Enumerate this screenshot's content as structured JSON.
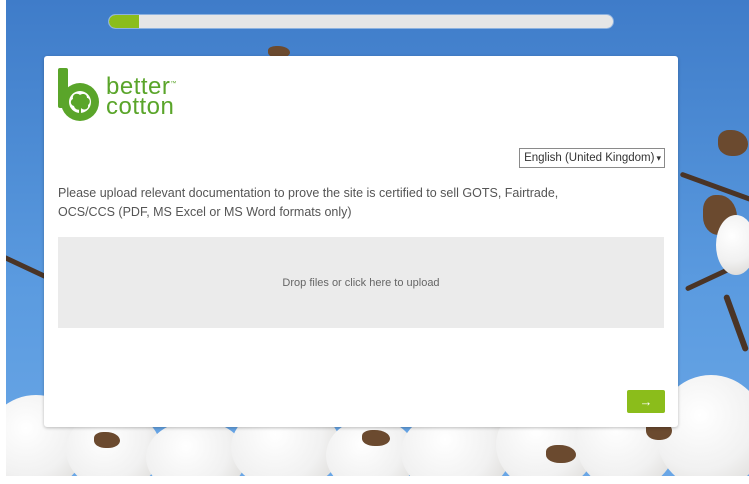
{
  "progress": {
    "percent": 6
  },
  "brand": {
    "line1": "better",
    "line2": "cotton",
    "tm": "™",
    "color": "#5aa52a",
    "logo_icon": "cotton-boll-b-icon"
  },
  "language": {
    "selected": "English (United Kingdom)",
    "chevron_icon": "chevron-down-icon"
  },
  "prompt": {
    "text": "Please upload relevant documentation to prove the site is certified to sell GOTS, Fairtrade, OCS/CCS (PDF, MS Excel or MS Word formats only)"
  },
  "upload": {
    "label": "Drop files or click here to upload"
  },
  "next": {
    "label": "→",
    "icon": "arrow-right-icon",
    "color": "#8bbd1b"
  }
}
